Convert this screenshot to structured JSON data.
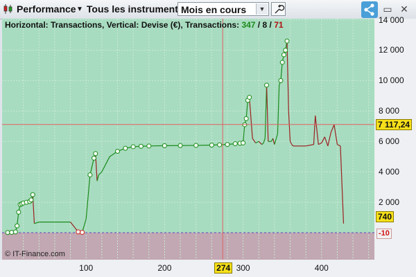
{
  "toolbar": {
    "performance_label": "Performance",
    "instruments_label": "Tous les instruments",
    "period_value": "Mois en cours"
  },
  "caption": {
    "prefix": "Horizontal: Transactions, Vertical: Devise (€), Transactions: ",
    "count_total": "347",
    "sep1": " / ",
    "count_mid": "8",
    "sep2": " / ",
    "count_neg": "71"
  },
  "copyright": "© IT-Finance.com",
  "y_axis_labels": [
    "14 000",
    "12 000",
    "10 000",
    "8 000",
    "6 000",
    "4 000",
    "2 000"
  ],
  "x_axis_labels": [
    "100",
    "200",
    "300",
    "400"
  ],
  "crosshair": {
    "x_value": "274",
    "y_value": "7 117,24"
  },
  "last_value": "740",
  "min_value": "-10",
  "colors": {
    "profit_area": "#a8dcc0",
    "loss_area": "#c2a8b2",
    "line_up": "#1a8a1a",
    "line_down": "#9a2020",
    "crosshair": "#e06060",
    "marker_bg": "#f7e01a"
  },
  "chart_data": {
    "type": "line",
    "xlim": [
      0,
      470
    ],
    "ylim": [
      -1800,
      14000
    ],
    "x": [
      0,
      5,
      10,
      12,
      14,
      16,
      18,
      20,
      24,
      28,
      30,
      32,
      34,
      40,
      60,
      80,
      90,
      95,
      100,
      105,
      110,
      112,
      114,
      116,
      120,
      125,
      130,
      140,
      150,
      160,
      170,
      180,
      200,
      220,
      240,
      260,
      270,
      280,
      290,
      296,
      300,
      302,
      304,
      306,
      308,
      312,
      316,
      320,
      324,
      326,
      328,
      330,
      332,
      336,
      338,
      340,
      344,
      346,
      348,
      350,
      352,
      354,
      356,
      358,
      360,
      362,
      364,
      370,
      380,
      390,
      392,
      396,
      400,
      404,
      408,
      412,
      416,
      420,
      424,
      428
    ],
    "y": [
      10,
      20,
      50,
      450,
      1350,
      1850,
      1900,
      1950,
      2000,
      2050,
      2150,
      2500,
      600,
      700,
      700,
      700,
      50,
      20,
      900,
      3800,
      4900,
      5200,
      3400,
      3800,
      4000,
      4500,
      5000,
      5350,
      5550,
      5650,
      5680,
      5700,
      5720,
      5730,
      5740,
      5760,
      5780,
      5800,
      5850,
      5880,
      5900,
      7100,
      7500,
      8700,
      8900,
      6200,
      5900,
      6000,
      5800,
      5900,
      6200,
      9700,
      6000,
      6000,
      6200,
      5800,
      6500,
      9700,
      10000,
      11200,
      11700,
      12000,
      12600,
      8000,
      6000,
      5800,
      5700,
      5700,
      5700,
      5800,
      7700,
      5800,
      5900,
      6300,
      5700,
      6600,
      7100,
      5800,
      5700,
      600,
      800
    ]
  }
}
